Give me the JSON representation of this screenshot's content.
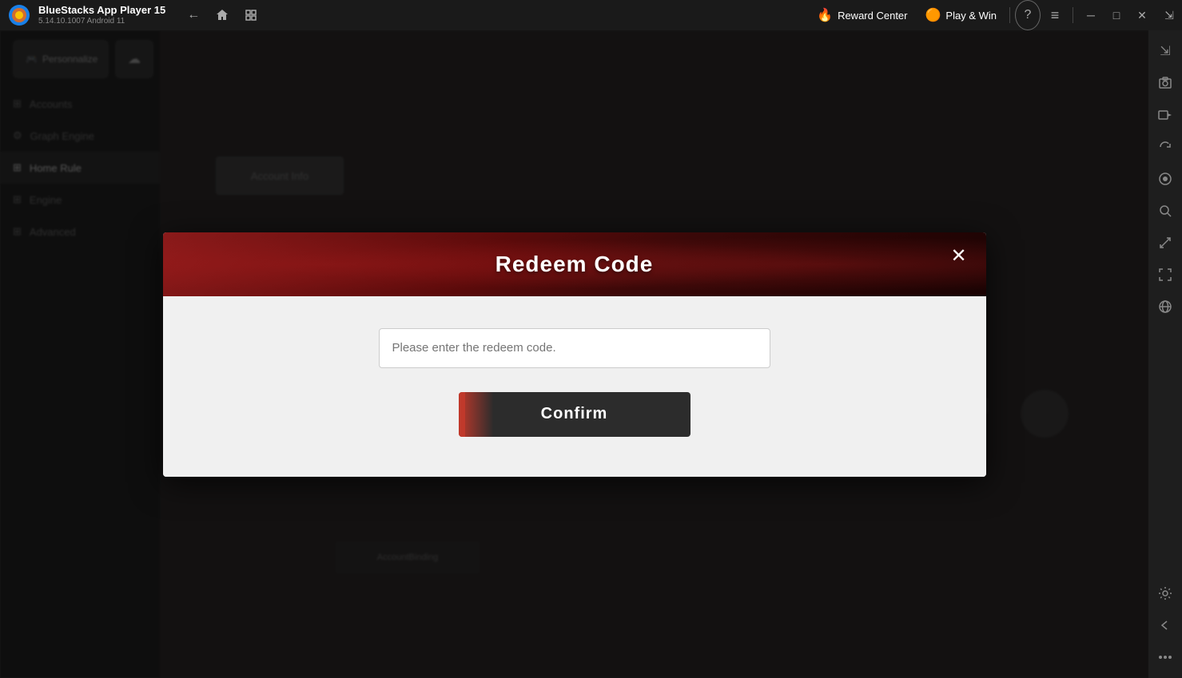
{
  "titlebar": {
    "app_name": "BlueStacks App Player 15",
    "version": "5.14.10.1007  Android 11",
    "back_label": "←",
    "home_label": "⌂",
    "layers_label": "❐",
    "reward_center_label": "Reward Center",
    "play_win_label": "Play & Win",
    "help_label": "?",
    "menu_label": "≡",
    "minimize_label": "─",
    "maximize_label": "□",
    "close_label": "✕",
    "expand_label": "⇲"
  },
  "right_sidebar": {
    "buttons": [
      {
        "name": "expand-icon",
        "label": "⇲"
      },
      {
        "name": "screenshot-icon",
        "label": "📷"
      },
      {
        "name": "camera2-icon",
        "label": "🎥"
      },
      {
        "name": "rotate-icon",
        "label": "↻"
      },
      {
        "name": "record-icon",
        "label": "⏺"
      },
      {
        "name": "zoom-icon",
        "label": "🔍"
      },
      {
        "name": "resize-icon",
        "label": "⤢"
      },
      {
        "name": "fullscreen-icon",
        "label": "⛶"
      },
      {
        "name": "globe-icon",
        "label": "🌐"
      },
      {
        "name": "settings2-icon",
        "label": "⚙"
      },
      {
        "name": "arrow-left-icon",
        "label": "←"
      },
      {
        "name": "more-icon",
        "label": "···"
      }
    ]
  },
  "modal": {
    "title": "Redeem Code",
    "close_label": "✕",
    "input_placeholder": "Please enter the redeem code.",
    "confirm_label": "Confirm",
    "description": ""
  }
}
